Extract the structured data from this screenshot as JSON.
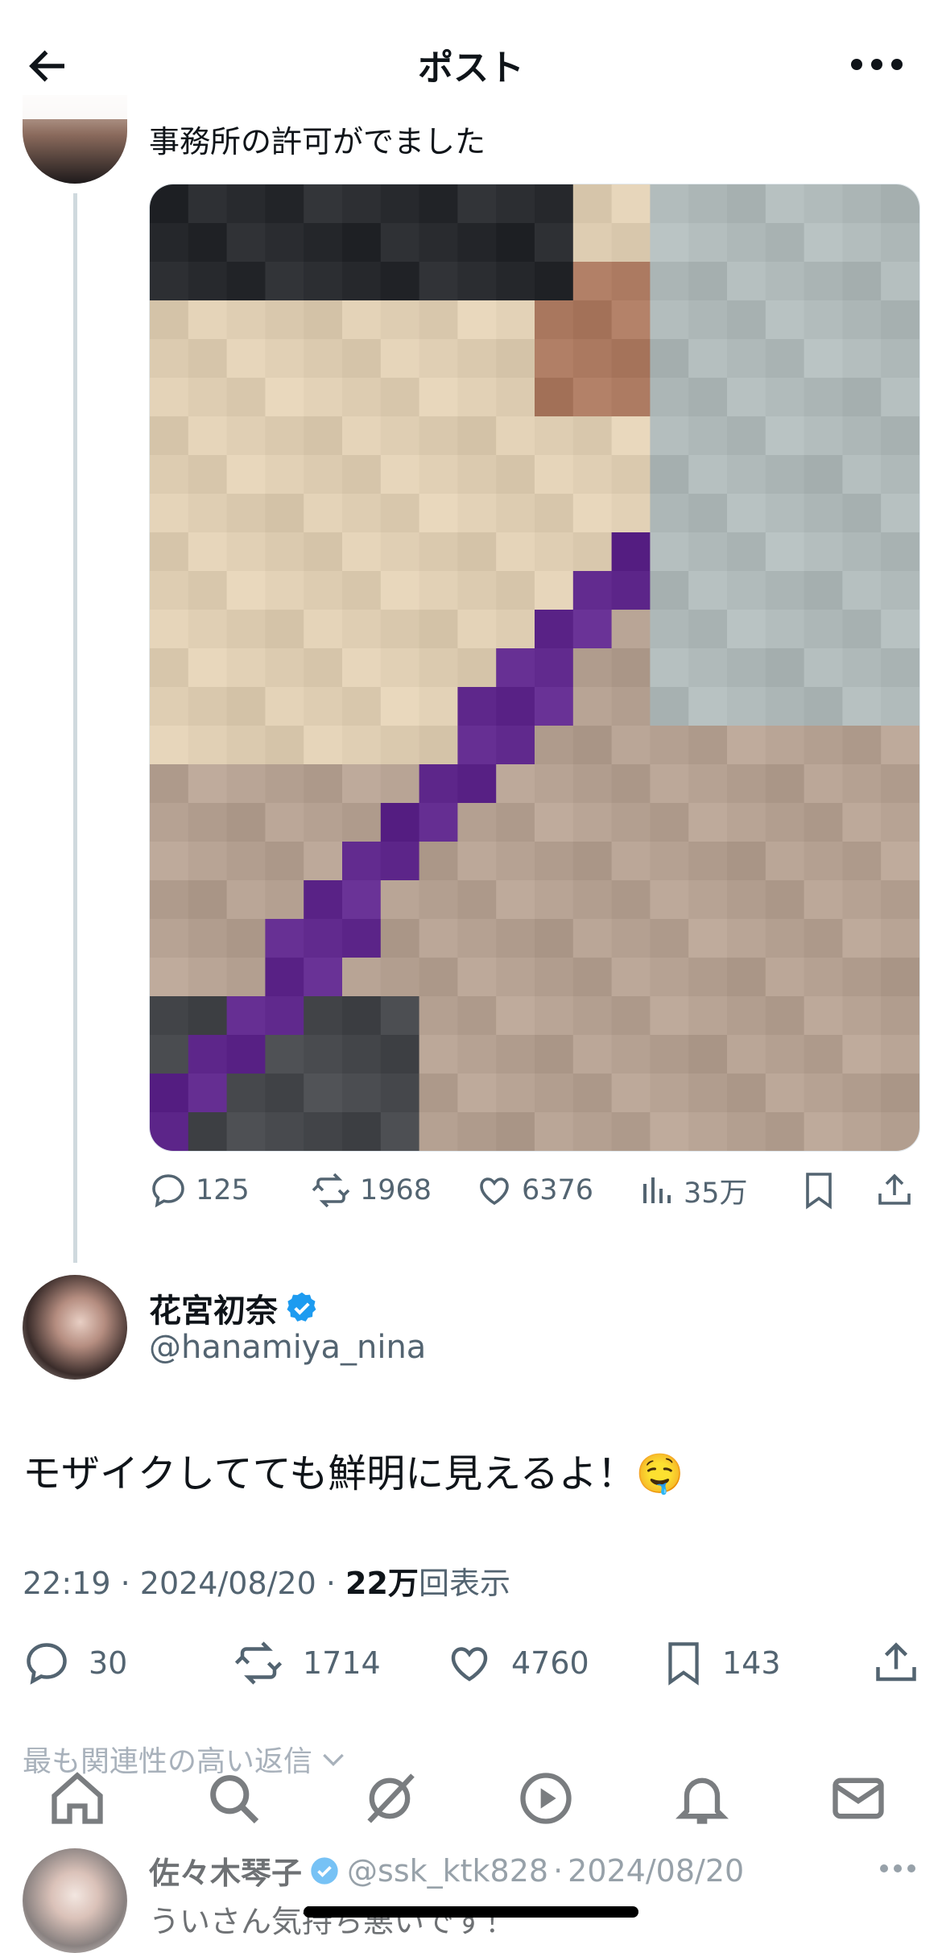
{
  "header": {
    "title": "ポスト"
  },
  "quoted_post": {
    "text": "事務所の許可がでました"
  },
  "quoted_actions": {
    "replies": "125",
    "reposts": "1968",
    "likes": "6376",
    "views": "35万"
  },
  "author": {
    "name": "花宮初奈",
    "handle": "@hanamiya_nina",
    "verified": true
  },
  "post": {
    "text": "モザイクしてても鮮明に見えるよ！🤤",
    "time": "22:19",
    "date": "2024/08/20",
    "views_count": "22万",
    "views_label": "回表示"
  },
  "post_actions": {
    "replies": "30",
    "reposts": "1714",
    "likes": "4760",
    "bookmarks": "143"
  },
  "replies_section": {
    "label": "最も関連性の高い返信"
  },
  "reply": {
    "name": "佐々木琴子",
    "handle": "@ssk_ktk828",
    "date": "2024/08/20",
    "text": "ういさん気持ち悪いです！"
  },
  "colors": {
    "accent": "#1d9bf0",
    "muted": "#536471",
    "text": "#0f1419"
  },
  "icons": [
    "back-arrow-icon",
    "more-icon",
    "reply-icon",
    "repost-icon",
    "like-icon",
    "views-icon",
    "bookmark-icon",
    "share-icon",
    "verified-icon",
    "chevron-down-icon",
    "home-icon",
    "search-icon",
    "grok-icon",
    "video-icon",
    "notifications-icon",
    "messages-icon"
  ]
}
